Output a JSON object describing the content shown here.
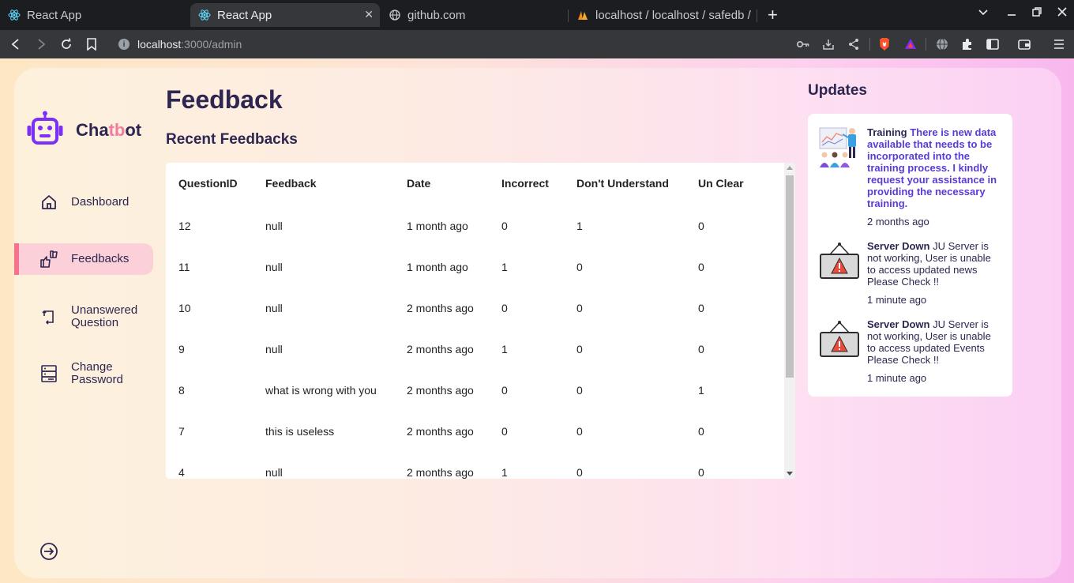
{
  "browser": {
    "tabs": [
      {
        "title": "React App",
        "icon": "react-icon"
      },
      {
        "title": "React App",
        "icon": "react-icon",
        "active": true
      },
      {
        "title": "github.com",
        "icon": "globe-icon"
      },
      {
        "title": "localhost / localhost / safedb /",
        "icon": "phpmyadmin-icon"
      }
    ],
    "address": {
      "host": "localhost",
      "path": ":3000/admin"
    }
  },
  "sidebar": {
    "logo": {
      "prefix": "Cha",
      "highlight": "tb",
      "suffix": "ot"
    },
    "items": [
      {
        "label": "Dashboard",
        "icon": "home-icon"
      },
      {
        "label": "Feedbacks",
        "icon": "thumbs-icon",
        "active": true
      },
      {
        "label": "Unanswered Question",
        "icon": "repeat-icon"
      },
      {
        "label": "Change Password",
        "icon": "server-icon"
      }
    ],
    "logout_icon": "logout-icon"
  },
  "main": {
    "title": "Feedback",
    "section_title": "Recent Feedbacks",
    "table": {
      "headers": [
        "QuestionID",
        "Feedback",
        "Date",
        "Incorrect",
        "Don't Understand",
        "Un Clear"
      ],
      "rows": [
        [
          "12",
          "null",
          "1 month ago",
          "0",
          "1",
          "0"
        ],
        [
          "11",
          "null",
          "1 month ago",
          "1",
          "0",
          "0"
        ],
        [
          "10",
          "null",
          "2 months ago",
          "0",
          "0",
          "0"
        ],
        [
          "9",
          "null",
          "2 months ago",
          "1",
          "0",
          "0"
        ],
        [
          "8",
          "what is wrong with you",
          "2 months ago",
          "0",
          "0",
          "1"
        ],
        [
          "7",
          "this is useless",
          "2 months ago",
          "0",
          "0",
          "0"
        ],
        [
          "4",
          "null",
          "2 months ago",
          "1",
          "0",
          "0"
        ]
      ]
    }
  },
  "updates": {
    "title": "Updates",
    "items": [
      {
        "heading": "Training",
        "body": "There is new data available that needs to be incorporated into the training process. I kindly request your assistance in providing the necessary training.",
        "time": "2 months ago",
        "icon": "training-illustration"
      },
      {
        "heading": "Server Down",
        "body": "JU Server is not working, User is unable to access updated news Please Check !!",
        "time": "1 minute ago",
        "icon": "warning-sign-icon"
      },
      {
        "heading": "Server Down",
        "body": "JU Server is not working, User is unable to access updated Events Please Check !!",
        "time": "1 minute ago",
        "icon": "warning-sign-icon"
      }
    ]
  },
  "colors": {
    "brand_dark": "#2d2650",
    "brand_pink": "#f17ca0",
    "logo_purple": "#7b2ff7",
    "active_bg": "#fbd0d8"
  }
}
